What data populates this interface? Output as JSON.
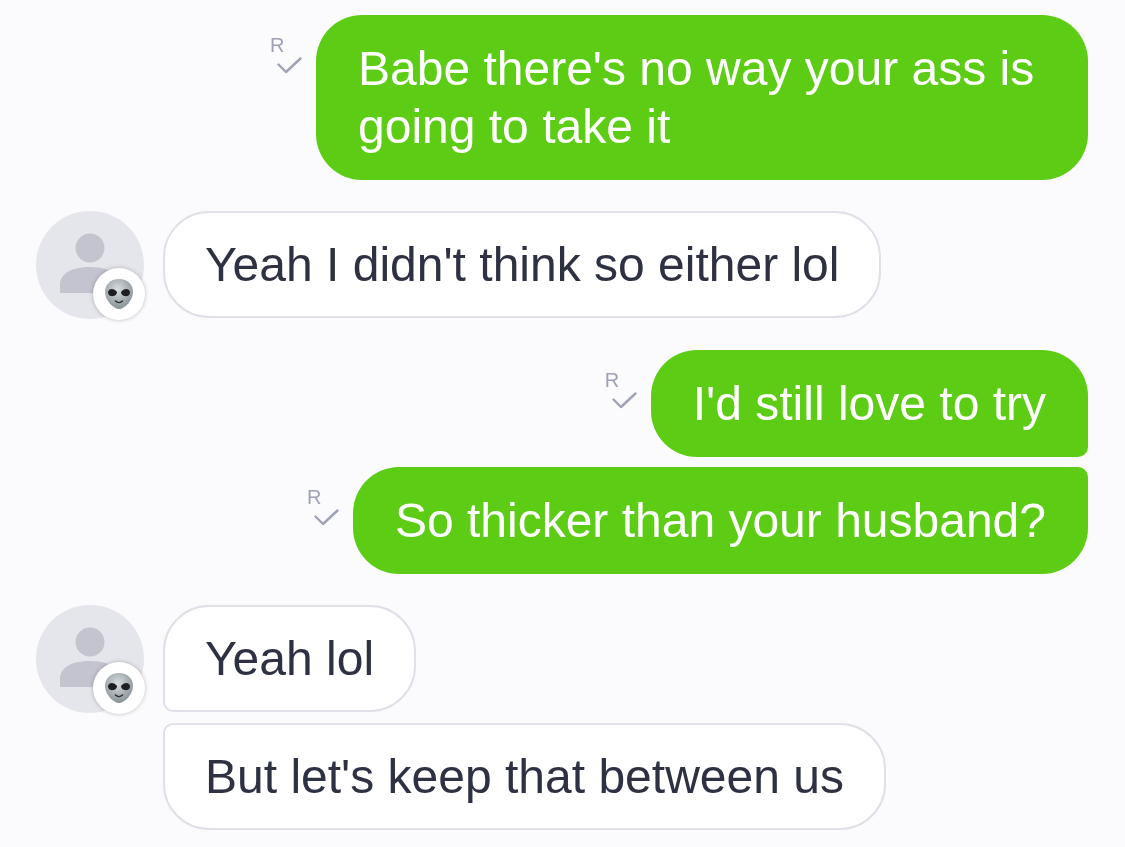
{
  "messages": [
    {
      "kind": "sent",
      "text": "Babe there's no way your ass is going to take it",
      "read": true,
      "read_mark": "R"
    },
    {
      "kind": "received",
      "text": "Yeah I didn't think so either lol"
    },
    {
      "kind": "sent",
      "text": "I'd still love to try",
      "read": true,
      "read_mark": "R"
    },
    {
      "kind": "sent",
      "text": "So thicker than your husband?",
      "read": true,
      "read_mark": "R"
    },
    {
      "kind": "received",
      "text": "Yeah lol"
    },
    {
      "kind": "received",
      "text": "But let's keep that between us"
    }
  ]
}
